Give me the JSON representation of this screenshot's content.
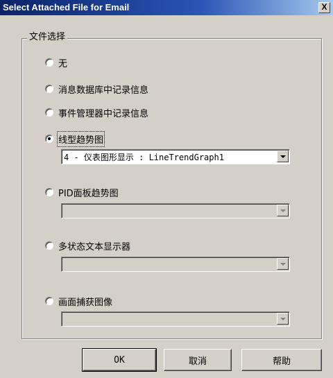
{
  "window": {
    "title": "Select Attached File for Email",
    "close_label": "X"
  },
  "group": {
    "label": "文件选择"
  },
  "options": [
    {
      "label": "无",
      "checked": false
    },
    {
      "label": "消息数据库中记录信息",
      "checked": false
    },
    {
      "label": "事件管理器中记录信息",
      "checked": false
    },
    {
      "label": "线型趋势图",
      "checked": true,
      "combo_value": "4 - 仪表图形显示 : LineTrendGraph1"
    },
    {
      "label": "PID面板趋势图",
      "checked": false,
      "combo_value": ""
    },
    {
      "label": "多状态文本显示器",
      "checked": false,
      "combo_value": ""
    },
    {
      "label": "画面捕获图像",
      "checked": false,
      "combo_value": ""
    }
  ],
  "buttons": {
    "ok": "OK",
    "cancel": "取消",
    "help": "帮助"
  }
}
